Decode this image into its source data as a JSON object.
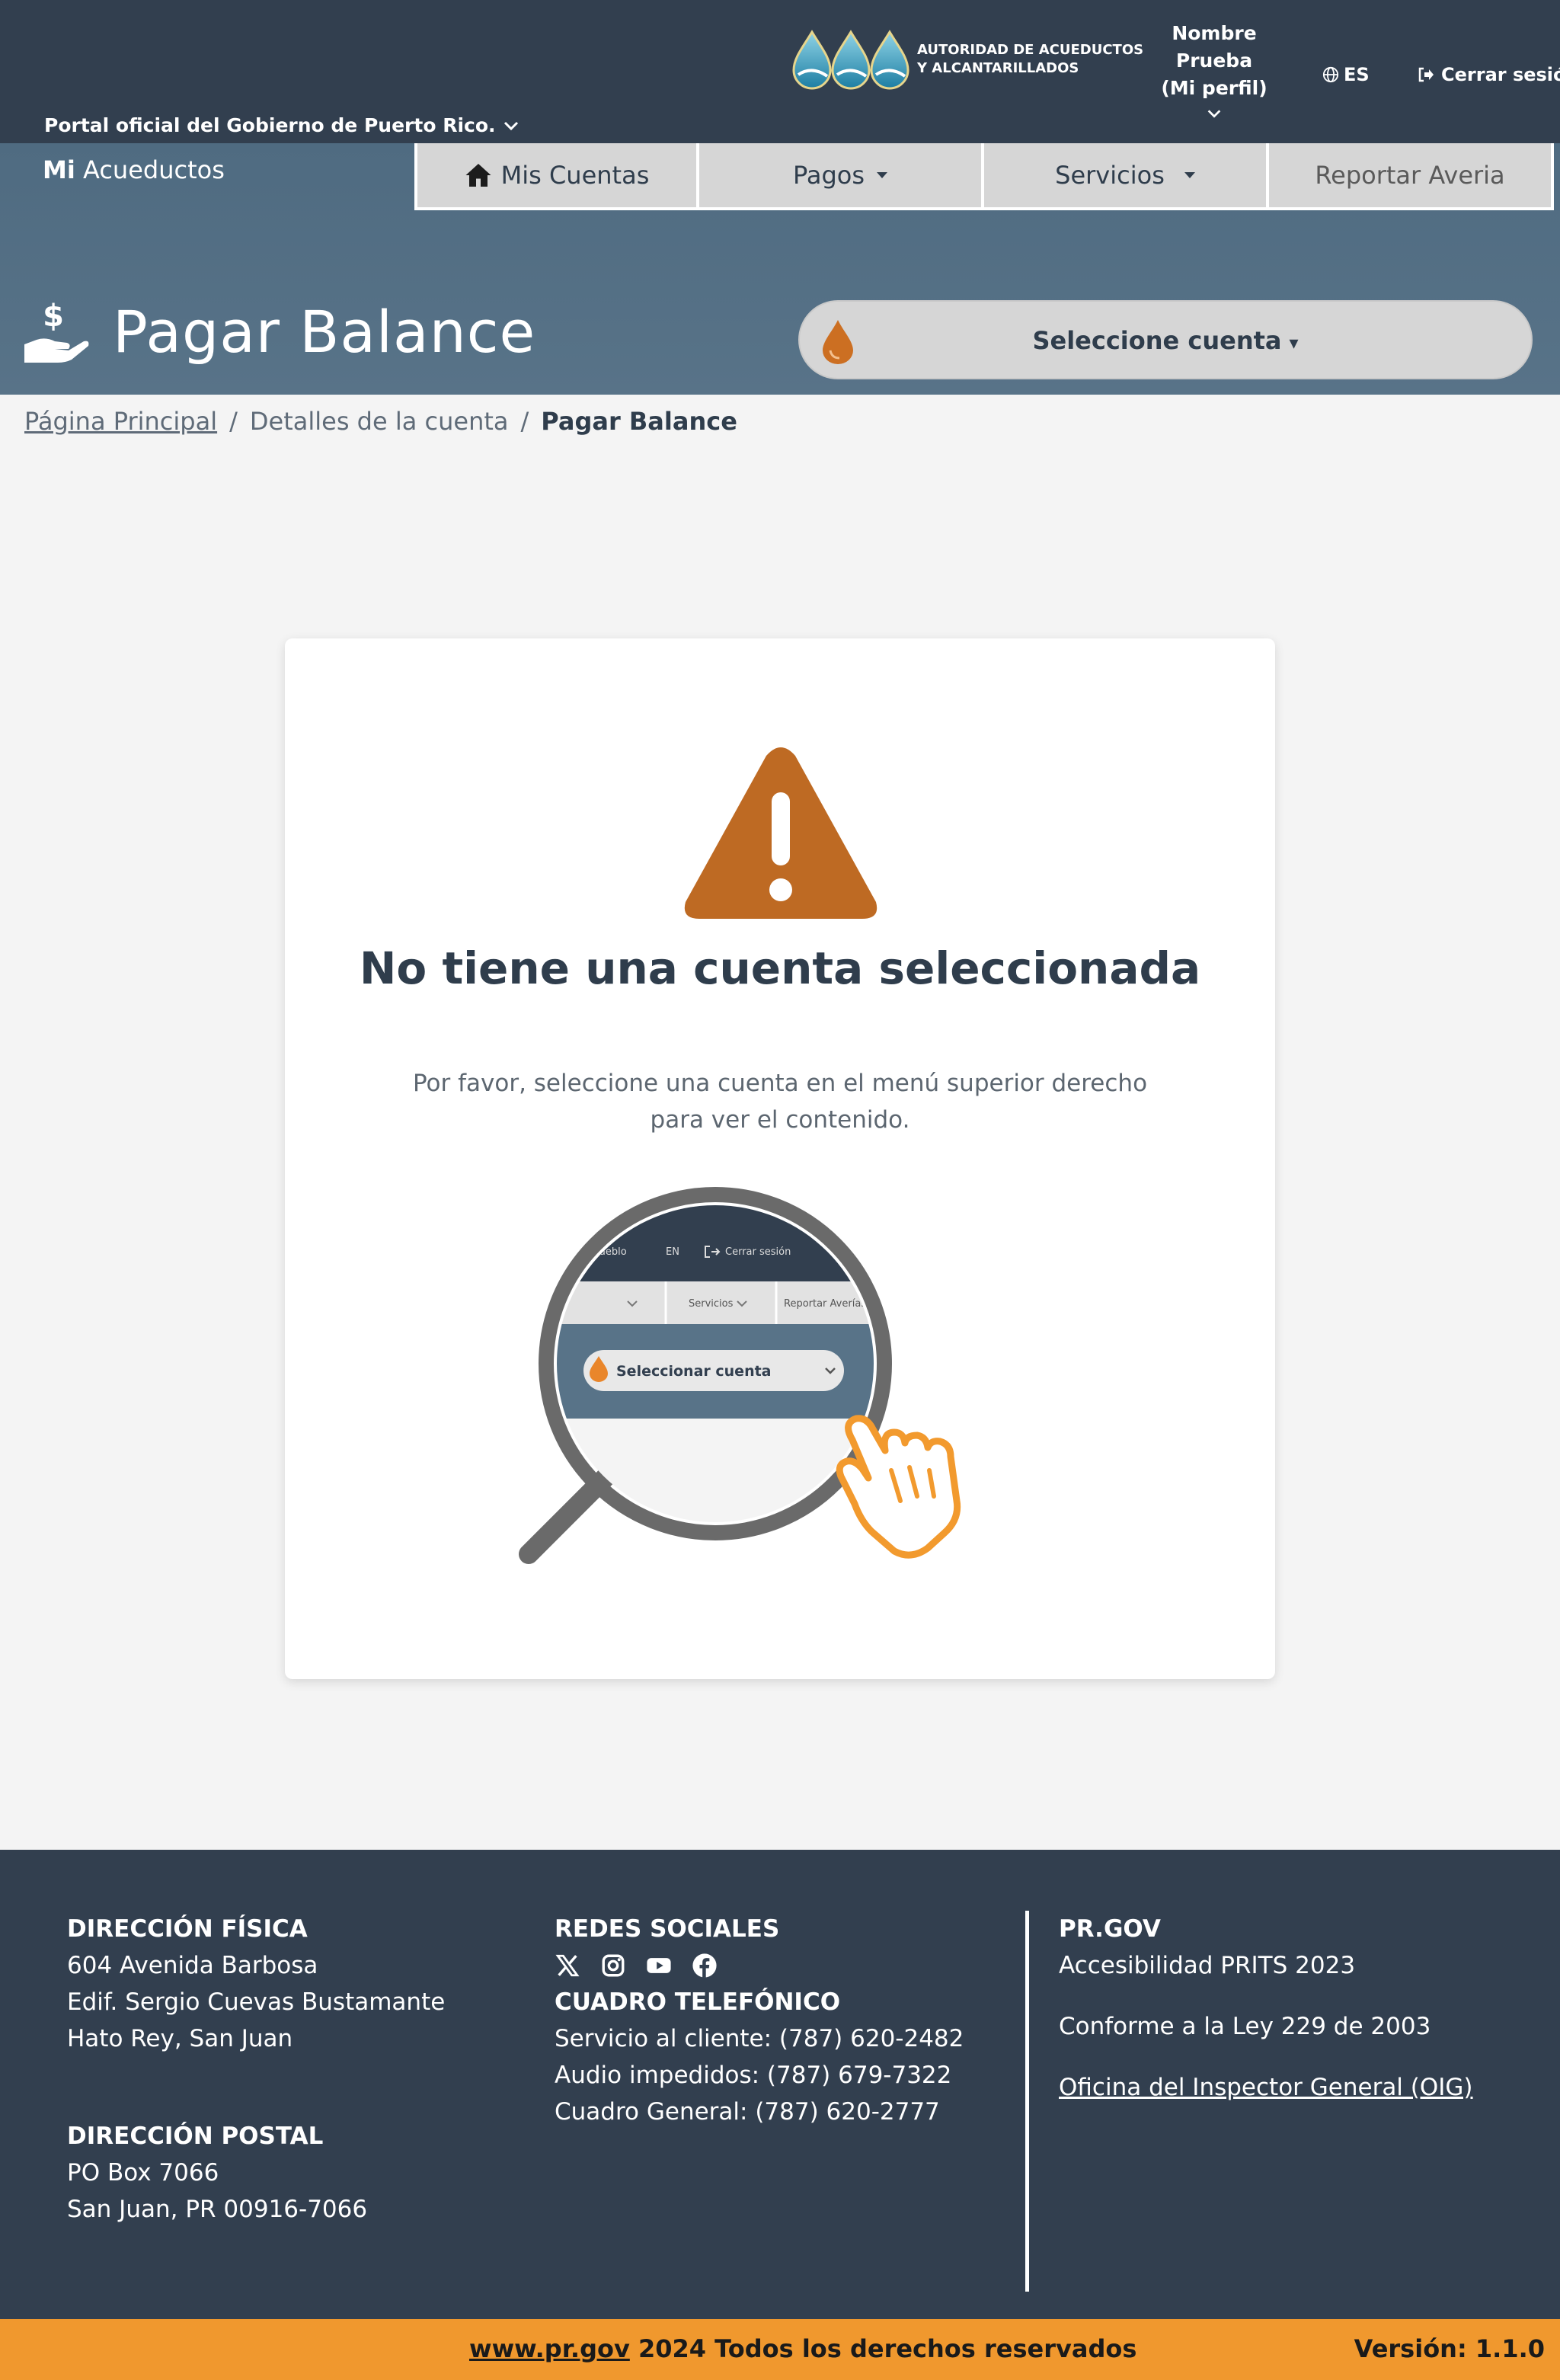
{
  "header": {
    "gov_label": "Portal oficial del Gobierno de Puerto Rico.",
    "logo_text_line1": "AUTORIDAD DE ACUEDUCTOS",
    "logo_text_line2": "Y ALCANTARILLADOS",
    "user_line1": "Nombre",
    "user_line2": "Prueba",
    "user_line3": "(Mi perfil)",
    "language": "ES",
    "logout": "Cerrar sesión"
  },
  "brand": {
    "prefix": "Mi",
    "name": "Acueductos"
  },
  "nav": {
    "items": [
      {
        "label": "Mis Cuentas",
        "icon": "home-icon"
      },
      {
        "label": "Pagos"
      },
      {
        "label": "Servicios"
      },
      {
        "label": "Reportar Averia"
      }
    ]
  },
  "page": {
    "title": "Pagar Balance",
    "icon": "hand-dollar-icon",
    "account_select_label": "Seleccione cuenta",
    "account_select_caret": "▾"
  },
  "breadcrumb": {
    "home": "Página Principal",
    "sep": "/",
    "details": "Detalles de la cuenta",
    "current": "Pagar Balance"
  },
  "card": {
    "title": "No tiene una cuenta seleccionada",
    "message": "Por favor, seleccione una cuenta en el menú superior derecho para ver el contenido.",
    "illus_nav1": "Pueblo",
    "illus_lang": "EN",
    "illus_logout": "Cerrar sesión",
    "illus_menu1": "Servicios",
    "illus_menu2": "Reportar Averías",
    "illus_select": "Seleccionar cuenta"
  },
  "footer": {
    "physical_title": "DIRECCIÓN FÍSICA",
    "physical_lines": [
      "604 Avenida Barbosa",
      "Edif. Sergio Cuevas Bustamante",
      "Hato Rey, San Juan"
    ],
    "postal_title": "DIRECCIÓN POSTAL",
    "postal_lines": [
      "PO Box 7066",
      "San Juan, PR 00916-7066"
    ],
    "social_title": "REDES SOCIALES",
    "social_icons": [
      "x-icon",
      "instagram-icon",
      "youtube-icon",
      "facebook-icon"
    ],
    "phone_title": "CUADRO TELEFÓNICO",
    "phone_lines": [
      "Servicio al cliente: (787) 620-2482",
      "Audio impedidos: (787) 679-7322",
      "Cuadro General: (787) 620-2777"
    ],
    "prgov_title": "PR.GOV",
    "accessibility": "Accesibilidad PRITS 2023",
    "law": "Conforme a la Ley 229 de 2003",
    "oig": "Oficina del Inspector General (OIG)"
  },
  "bottom": {
    "site": "www.pr.gov",
    "rights": " 2024 Todos los derechos reservados",
    "version": "Versión: 1.1.0"
  },
  "colors": {
    "dark_navy": "#323f4f",
    "steel_blue": "#587388",
    "accent_orange": "#f0982e",
    "warning_orange": "#be6a23"
  }
}
